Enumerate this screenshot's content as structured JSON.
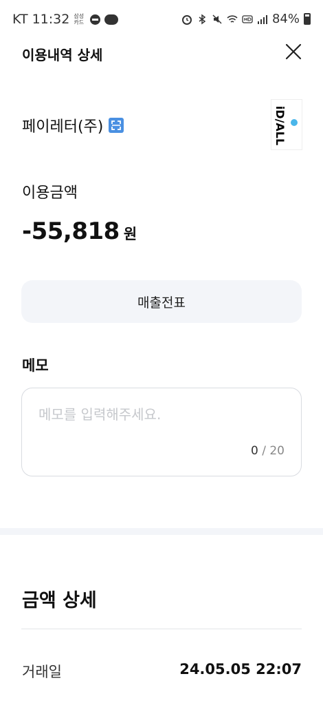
{
  "status_bar": {
    "carrier": "KT",
    "time": "11:32",
    "app_label": "삼성카드",
    "battery": "84%",
    "icons": [
      "do-not-disturb-icon",
      "cloud-icon",
      "alarm-icon",
      "bluetooth-icon",
      "mute-icon",
      "wifi-icon",
      "hd-icon",
      "signal-icon",
      "battery-icon"
    ]
  },
  "header": {
    "title": "이용내역 상세",
    "close_icon": "close-icon"
  },
  "merchant": {
    "name": "페이레터(주)",
    "scan_icon": "scan-icon",
    "logo_text": "iD/ALL"
  },
  "amount": {
    "label": "이용금액",
    "value": "-55,818",
    "unit": "원"
  },
  "receipt_button": {
    "label": "매출전표"
  },
  "memo": {
    "title": "메모",
    "value": "",
    "placeholder": "메모를 입력해주세요.",
    "count": "0",
    "max": "/ 20"
  },
  "details": {
    "title": "금액 상세",
    "rows": [
      {
        "key": "거래일",
        "value": "24.05.05 22:07"
      }
    ]
  },
  "colors": {
    "accent_blue": "#4a90e2",
    "button_bg": "#f3f5f9",
    "placeholder": "#c6c8cc"
  }
}
